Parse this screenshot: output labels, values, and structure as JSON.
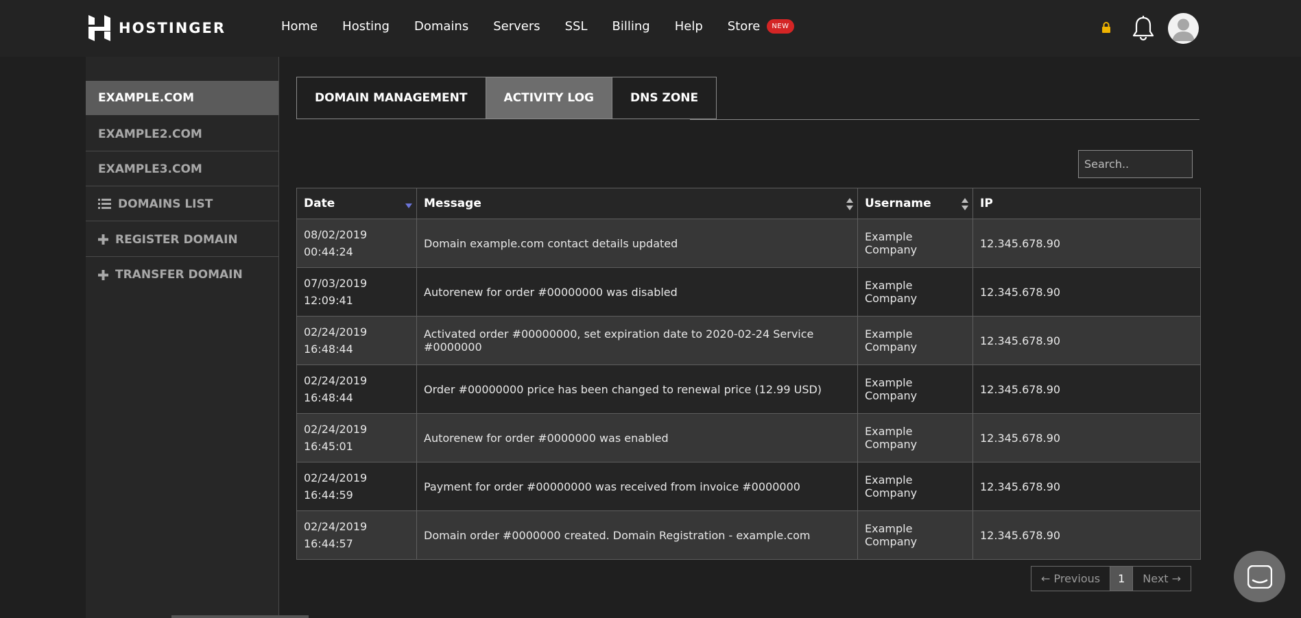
{
  "header": {
    "logo_text": "HOSTINGER",
    "nav": [
      "Home",
      "Hosting",
      "Domains",
      "Servers",
      "SSL",
      "Billing",
      "Help"
    ],
    "store_label": "Store",
    "store_badge": "NEW"
  },
  "sidebar": {
    "domains": [
      "EXAMPLE.COM",
      "EXAMPLE2.COM",
      "EXAMPLE3.COM"
    ],
    "actions": [
      {
        "label": "DOMAINS LIST",
        "icon": "list-icon"
      },
      {
        "label": "REGISTER DOMAIN",
        "icon": "plus-icon"
      },
      {
        "label": "TRANSFER DOMAIN",
        "icon": "plus-icon"
      }
    ]
  },
  "tabs": [
    {
      "label": "DOMAIN MANAGEMENT",
      "active": false
    },
    {
      "label": "ACTIVITY LOG",
      "active": true
    },
    {
      "label": "DNS ZONE",
      "active": false
    }
  ],
  "search": {
    "placeholder": "Search.."
  },
  "table": {
    "columns": [
      "Date",
      "Message",
      "Username",
      "IP"
    ],
    "rows": [
      {
        "date": "08/02/2019",
        "time": "00:44:24",
        "message": "Domain example.com contact details updated",
        "username": "Example Company",
        "ip": "12.345.678.90"
      },
      {
        "date": "07/03/2019",
        "time": "12:09:41",
        "message": "Autorenew for order #00000000 was disabled",
        "username": "Example Company",
        "ip": "12.345.678.90"
      },
      {
        "date": "02/24/2019",
        "time": "16:48:44",
        "message": "Activated order #00000000, set expiration date to 2020-02-24 Service #0000000",
        "username": "Example Company",
        "ip": "12.345.678.90"
      },
      {
        "date": "02/24/2019",
        "time": "16:48:44",
        "message": "Order #00000000 price has been changed to renewal price (12.99 USD)",
        "username": "Example Company",
        "ip": "12.345.678.90"
      },
      {
        "date": "02/24/2019",
        "time": "16:45:01",
        "message": "Autorenew for order #0000000 was enabled",
        "username": "Example Company",
        "ip": "12.345.678.90"
      },
      {
        "date": "02/24/2019",
        "time": "16:44:59",
        "message": "Payment for order #00000000 was received from invoice #0000000",
        "username": "Example Company",
        "ip": "12.345.678.90"
      },
      {
        "date": "02/24/2019",
        "time": "16:44:57",
        "message": "Domain order #0000000 created. Domain Registration - example.com",
        "username": "Example Company",
        "ip": "12.345.678.90"
      }
    ]
  },
  "pagination": {
    "previous": "← Previous",
    "current": "1",
    "next": "Next →"
  },
  "colors": {
    "accent_badge": "#d42525",
    "lock": "#f0b400",
    "active_tab": "#6d6d6d",
    "active_sidebar": "#5b5b5b"
  }
}
